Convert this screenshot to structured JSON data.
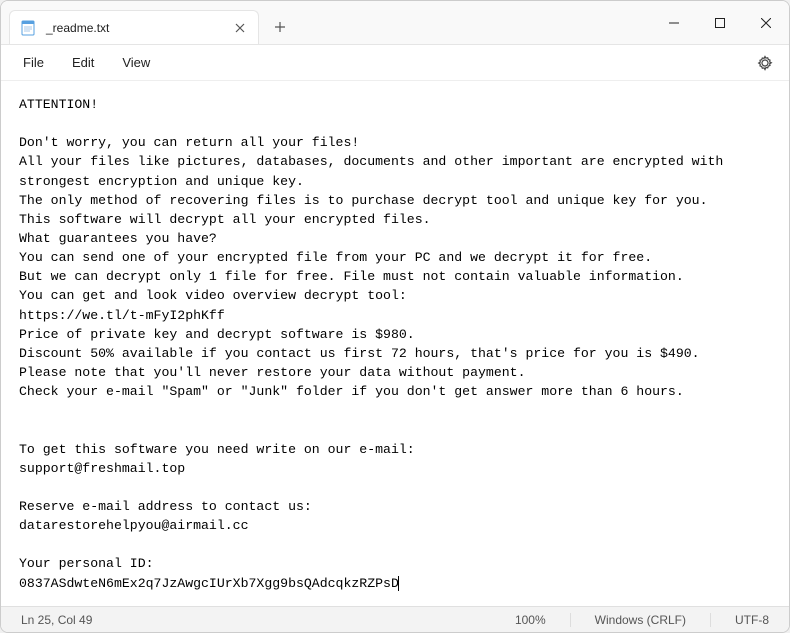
{
  "tab": {
    "title": "_readme.txt",
    "icon": "notepad-icon"
  },
  "menu": {
    "file": "File",
    "edit": "Edit",
    "view": "View"
  },
  "content": {
    "lines": [
      "ATTENTION!",
      "",
      "Don't worry, you can return all your files!",
      "All your files like pictures, databases, documents and other important are encrypted with strongest encryption and unique key.",
      "The only method of recovering files is to purchase decrypt tool and unique key for you.",
      "This software will decrypt all your encrypted files.",
      "What guarantees you have?",
      "You can send one of your encrypted file from your PC and we decrypt it for free.",
      "But we can decrypt only 1 file for free. File must not contain valuable information.",
      "You can get and look video overview decrypt tool:",
      "https://we.tl/t-mFyI2phKff",
      "Price of private key and decrypt software is $980.",
      "Discount 50% available if you contact us first 72 hours, that's price for you is $490.",
      "Please note that you'll never restore your data without payment.",
      "Check your e-mail \"Spam\" or \"Junk\" folder if you don't get answer more than 6 hours.",
      "",
      "",
      "To get this software you need write on our e-mail:",
      "support@freshmail.top",
      "",
      "Reserve e-mail address to contact us:",
      "datarestorehelpyou@airmail.cc",
      "",
      "Your personal ID:",
      "0837ASdwteN6mEx2q7JzAwgcIUrXb7Xgg9bsQAdcqkzRZPsD"
    ]
  },
  "status": {
    "position": "Ln 25, Col 49",
    "zoom": "100%",
    "line_ending": "Windows (CRLF)",
    "encoding": "UTF-8"
  }
}
